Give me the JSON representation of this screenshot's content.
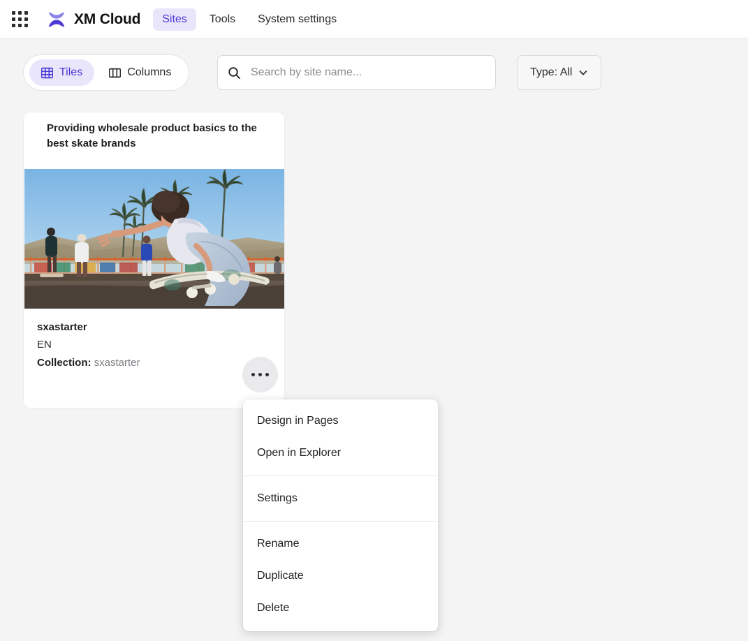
{
  "header": {
    "launcher_icon": "app-grid-icon",
    "logo_icon": "sitecore-logo-icon",
    "title": "XM Cloud",
    "nav": [
      {
        "label": "Sites",
        "active": true
      },
      {
        "label": "Tools",
        "active": false
      },
      {
        "label": "System settings",
        "active": false
      }
    ]
  },
  "toolbar": {
    "view_toggle": [
      {
        "label": "Tiles",
        "icon": "tiles-grid-icon",
        "active": true
      },
      {
        "label": "Columns",
        "icon": "columns-icon",
        "active": false
      }
    ],
    "search": {
      "icon": "search-icon",
      "placeholder": "Search by site name...",
      "value": ""
    },
    "type_filter": {
      "label": "Type: All",
      "icon": "chevron-down-icon"
    }
  },
  "site_card": {
    "title": "Providing wholesale product basics to the best skate brands",
    "thumbnail_alt": "skateboarder at skate park with palm trees",
    "name": "sxastarter",
    "language": "EN",
    "collection_label": "Collection:",
    "collection_value": "sxastarter",
    "more_button_icon": "ellipsis-icon"
  },
  "context_menu": {
    "groups": [
      {
        "items": [
          {
            "label": "Design in Pages"
          },
          {
            "label": "Open in Explorer"
          }
        ]
      },
      {
        "items": [
          {
            "label": "Settings"
          }
        ]
      },
      {
        "items": [
          {
            "label": "Rename"
          },
          {
            "label": "Duplicate"
          },
          {
            "label": "Delete"
          }
        ]
      }
    ]
  },
  "colors": {
    "accent": "#4b3ad6",
    "accent_bg": "#e9e6fb",
    "page_bg": "#f4f4f5",
    "surface": "#ffffff",
    "text": "#1f1f21",
    "muted_text": "#7d7d83"
  }
}
